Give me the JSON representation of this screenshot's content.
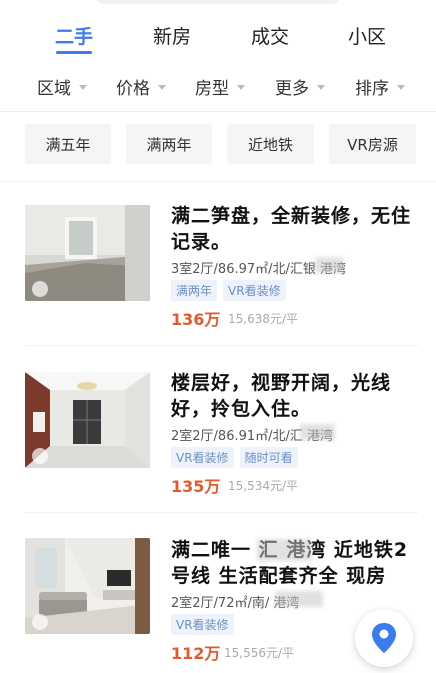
{
  "tabs": [
    {
      "label": "二手",
      "active": true
    },
    {
      "label": "新房",
      "active": false
    },
    {
      "label": "成交",
      "active": false
    },
    {
      "label": "小区",
      "active": false
    }
  ],
  "filters": [
    "区域",
    "价格",
    "房型",
    "更多",
    "排序"
  ],
  "quick_filters": [
    "满五年",
    "满两年",
    "近地铁",
    "VR房源"
  ],
  "listings": [
    {
      "title": "满二笋盘，全新装修，无住记录。",
      "meta": "3室2厅/86.97㎡/北/汇银 港湾",
      "tags": [
        "满两年",
        "VR看装修"
      ],
      "price": "136万",
      "unit_price": "15,638元/平"
    },
    {
      "title": "楼层好，视野开阔，光线好，拎包入住。",
      "meta": "2室2厅/86.91㎡/北/汇 港湾",
      "tags": [
        "VR看装修",
        "随时可看"
      ],
      "price": "135万",
      "unit_price": "15,534元/平"
    },
    {
      "title": "满二唯一 汇 港湾 近地铁2号线 生活配套齐全 现房",
      "meta": "2室2厅/72㎡/南/ 港湾",
      "tags": [
        "VR看装修"
      ],
      "price": "112万",
      "unit_price": "15,556元/平"
    }
  ],
  "colors": {
    "accent": "#3a7bf0",
    "price": "#e45a2c",
    "tag_bg": "#eef3fb",
    "tag_text": "#6b8fc6"
  },
  "map_button_icon": "location-pin-icon"
}
